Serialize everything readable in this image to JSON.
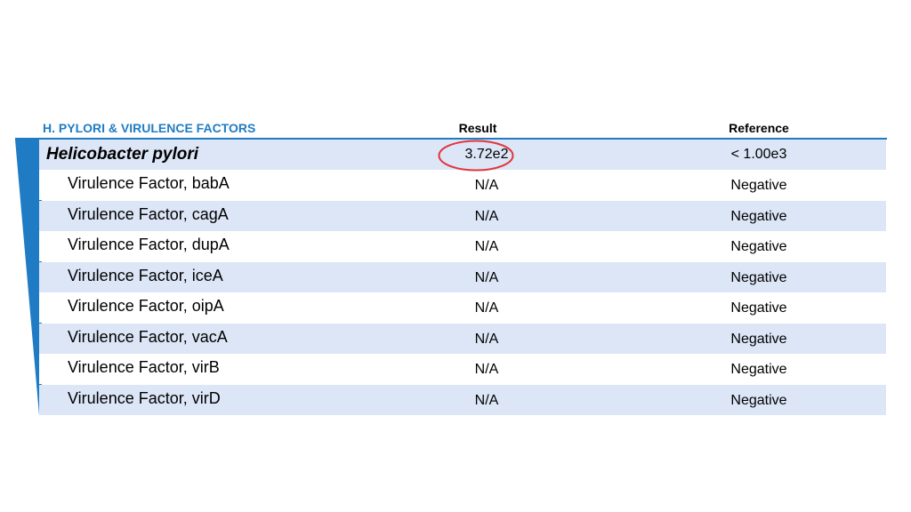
{
  "table": {
    "section_title": "H. PYLORI & VIRULENCE FACTORS",
    "result_header": "Result",
    "reference_header": "Reference",
    "main_row": {
      "name": "Helicobacter pylori",
      "result": "3.72e2",
      "reference": "< 1.00e3"
    },
    "rows": [
      {
        "name": "Virulence Factor, babA",
        "result": "N/A",
        "reference": "Negative"
      },
      {
        "name": "Virulence Factor, cagA",
        "result": "N/A",
        "reference": "Negative"
      },
      {
        "name": "Virulence Factor, dupA",
        "result": "N/A",
        "reference": "Negative"
      },
      {
        "name": "Virulence Factor, iceA",
        "result": "N/A",
        "reference": "Negative"
      },
      {
        "name": "Virulence Factor, oipA",
        "result": "N/A",
        "reference": "Negative"
      },
      {
        "name": "Virulence Factor, vacA",
        "result": "N/A",
        "reference": "Negative"
      },
      {
        "name": "Virulence Factor, virB",
        "result": "N/A",
        "reference": "Negative"
      },
      {
        "name": "Virulence Factor, virD",
        "result": "N/A",
        "reference": "Negative"
      }
    ]
  },
  "colors": {
    "accent_blue": "#1f7cc4",
    "row_shade": "#dce6f6",
    "highlight_circle": "#e2343c"
  }
}
